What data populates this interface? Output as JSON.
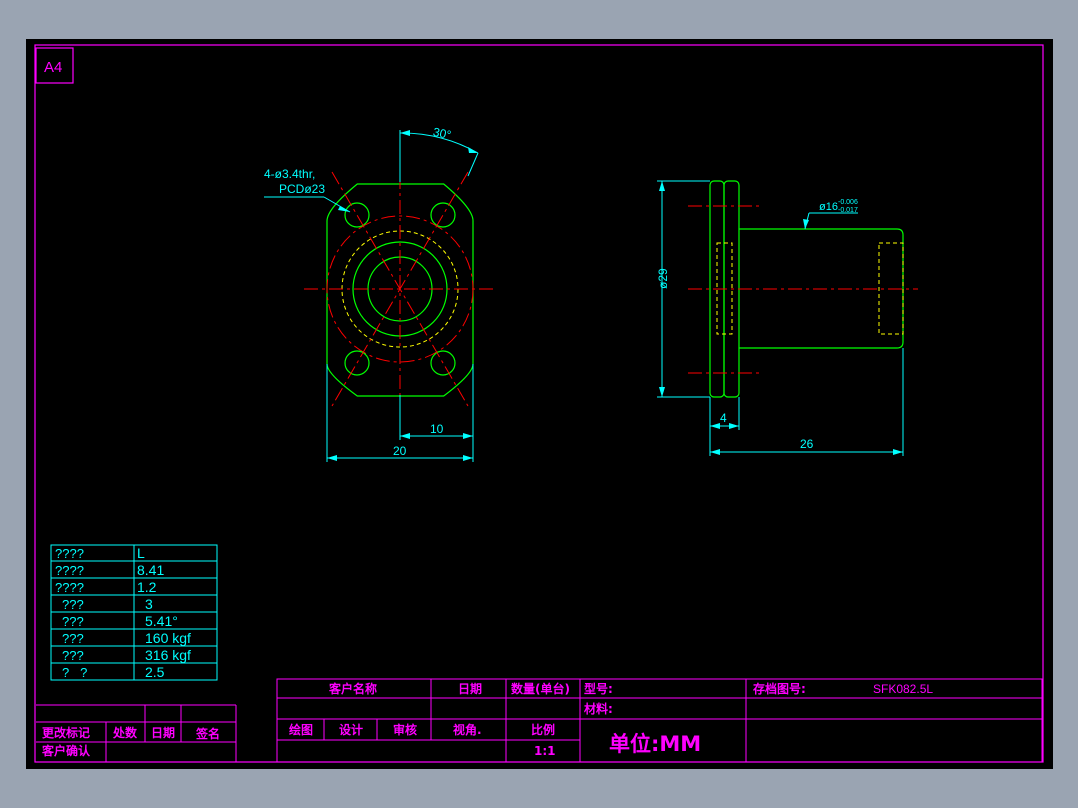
{
  "sheet": {
    "size_label": "A4"
  },
  "colors": {
    "background": "#000000",
    "frame": "#ff00ff",
    "outline": "#00ff00",
    "hidden": "#ffff00",
    "centerline": "#ff0000",
    "dimension": "#00ffff",
    "inner_circle": "#00ff00"
  },
  "front_view": {
    "hole_callout_line1": "4-ø3.4thr,",
    "hole_callout_line2": "PCDø23",
    "angle": "30°",
    "dim_width_total": "20",
    "dim_width_half": "10"
  },
  "side_view": {
    "dim_flange_dia": "ø29",
    "dim_shaft_dia": "ø16",
    "tol_upper": "-0.006",
    "tol_lower": "-0.017",
    "dim_flange_thk": "4",
    "dim_length": "26"
  },
  "spec_table": {
    "rows": [
      {
        "label": "????",
        "value": "L"
      },
      {
        "label": "????",
        "value": "8.41"
      },
      {
        "label": "????",
        "value": "1.2"
      },
      {
        "label": "???",
        "value": "3"
      },
      {
        "label": "???",
        "value": "5.41°"
      },
      {
        "label": "???",
        "value": "160  kgf"
      },
      {
        "label": "???",
        "value": "316  kgf"
      },
      {
        "label": "?   ?",
        "value": "2.5"
      }
    ]
  },
  "revision_block": {
    "change_mark": "更改标记",
    "count": "处数",
    "date": "日期",
    "signature": "签名",
    "customer_confirm": "客户确认"
  },
  "title_block": {
    "customer_name": "客户名称",
    "date": "日期",
    "quantity": "数量(单台)",
    "model": "型号:",
    "archive_no_label": "存档图号:",
    "archive_no": "SFK082.5L",
    "material": "材料:",
    "drawn": "绘图",
    "design": "设计",
    "review": "审核",
    "view_angle": "视角.",
    "scale_label": "比例",
    "scale": "1:1",
    "unit": "单位:MM"
  }
}
